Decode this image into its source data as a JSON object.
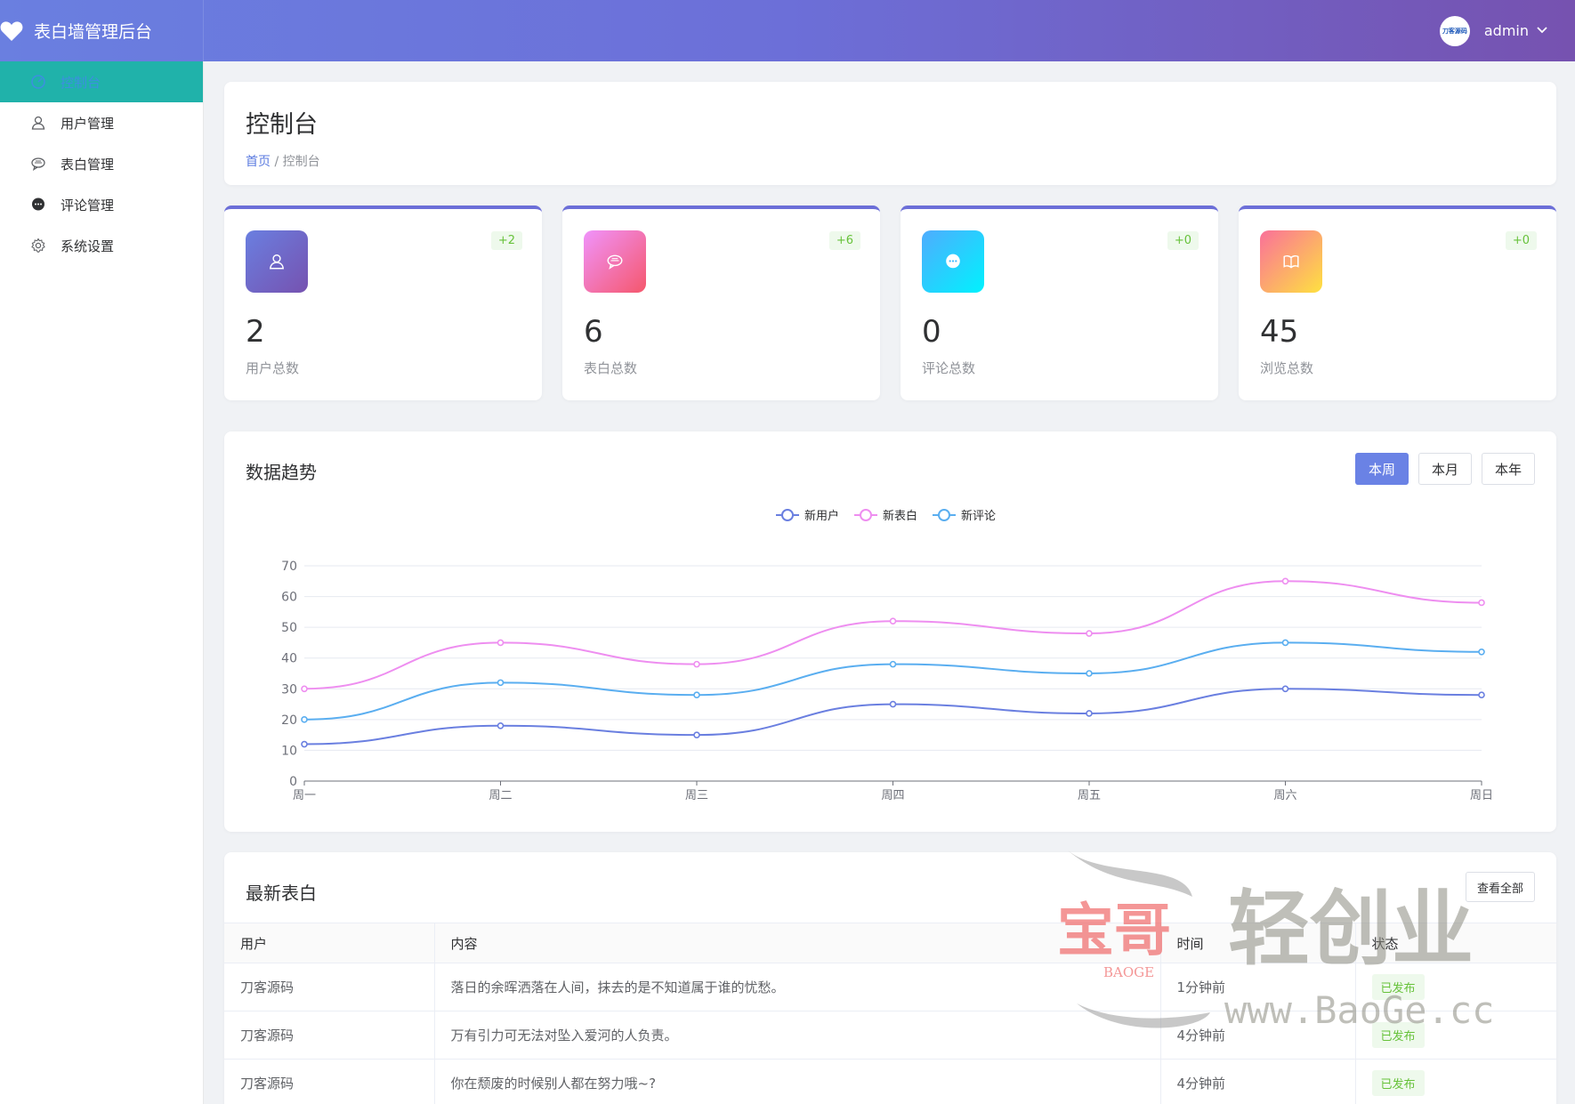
{
  "header": {
    "app_title": "表白墙管理后台",
    "user_name": "admin",
    "avatar_text": "刀客源码"
  },
  "sidebar": {
    "items": [
      {
        "label": "控制台",
        "icon": "dashboard-icon",
        "active": true
      },
      {
        "label": "用户管理",
        "icon": "user-icon"
      },
      {
        "label": "表白管理",
        "icon": "chat-bubble-icon"
      },
      {
        "label": "评论管理",
        "icon": "comment-icon"
      },
      {
        "label": "系统设置",
        "icon": "gear-icon"
      }
    ]
  },
  "page": {
    "title": "控制台",
    "breadcrumb_home": "首页",
    "breadcrumb_sep": "/",
    "breadcrumb_current": "控制台"
  },
  "stats": [
    {
      "value": "2",
      "label": "用户总数",
      "delta": "+2",
      "icon": "user-icon",
      "color_from": "#6a7fe0",
      "color_to": "#7652b0"
    },
    {
      "value": "6",
      "label": "表白总数",
      "delta": "+6",
      "icon": "chat-bubble-icon",
      "color_from": "#f093fb",
      "color_to": "#f5576c"
    },
    {
      "value": "0",
      "label": "评论总数",
      "delta": "+0",
      "icon": "comment-icon",
      "color_from": "#4facfe",
      "color_to": "#00f2fe"
    },
    {
      "value": "45",
      "label": "浏览总数",
      "delta": "+0",
      "icon": "book-icon",
      "color_from": "#fa709a",
      "color_to": "#fee140"
    }
  ],
  "trend": {
    "title": "数据趋势",
    "range_buttons": [
      "本周",
      "本月",
      "本年"
    ],
    "active_range": "本周"
  },
  "chart_data": {
    "type": "line",
    "categories": [
      "周一",
      "周二",
      "周三",
      "周四",
      "周五",
      "周六",
      "周日"
    ],
    "ylim": [
      0,
      70
    ],
    "yticks": [
      0,
      10,
      20,
      30,
      40,
      50,
      60,
      70
    ],
    "legend_position": "top-center",
    "smooth": true,
    "series": [
      {
        "name": "新用户",
        "color": "#6a7fe0",
        "values": [
          12,
          18,
          15,
          25,
          22,
          30,
          28
        ]
      },
      {
        "name": "新表白",
        "color": "#ee8ef0",
        "values": [
          30,
          45,
          38,
          52,
          48,
          65,
          58
        ]
      },
      {
        "name": "新评论",
        "color": "#5aaef0",
        "values": [
          20,
          32,
          28,
          38,
          35,
          45,
          42
        ]
      }
    ]
  },
  "latest": {
    "title": "最新表白",
    "view_all": "查看全部",
    "columns": [
      "用户",
      "内容",
      "时间",
      "状态"
    ],
    "rows": [
      {
        "user": "刀客源码",
        "content": "落日的余晖洒落在人间，抹去的是不知道属于谁的忧愁。",
        "time": "1分钟前",
        "status": "已发布"
      },
      {
        "user": "刀客源码",
        "content": "万有引力可无法对坠入爱河的人负责。",
        "time": "4分钟前",
        "status": "已发布"
      },
      {
        "user": "刀客源码",
        "content": "你在颓废的时候别人都在努力哦~?",
        "time": "4分钟前",
        "status": "已发布"
      }
    ]
  },
  "watermark": {
    "brand": "宝哥",
    "chars": "轻创业",
    "sub": "BAOGE",
    "url": "www.BaoGe.cc"
  }
}
